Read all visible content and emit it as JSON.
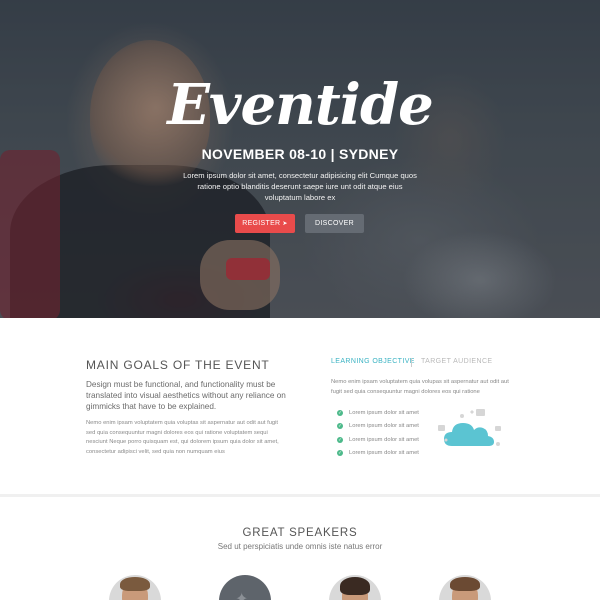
{
  "hero": {
    "logo_text": "Eventide",
    "dates": "NOVEMBER 08-10 | SYDNEY",
    "intro": "Lorem ipsum dolor sit amet, consectetur adipisicing elit Cumque quos ratione optio  blanditis deserunt saepe iure unt odit atque eius voluptatum labore ex",
    "register_label": "REGISTER",
    "register_icon": "chevron-right-circle-icon",
    "discover_label": "DISCOVER",
    "colors": {
      "register": "#e94b4b",
      "discover": "#656b73"
    }
  },
  "goals": {
    "title": "MAIN GOALS OF THE EVENT",
    "lead": "Design must be functional, and functionality must be translated into visual aesthetics without any reliance on gimmicks that have to be explained.",
    "body": "Nemo enim ipsam voluptatem quia voluptas sit aspernatur aut odit aut fugit sed quia consequuntur magni dolores eos qui ratione voluptatem sequi nesciunt Neque porro quisquam est, qui dolorem ipsum quia dolor sit amet, consectetur adipisci velit, sed quia non numquam eius",
    "tabs": [
      {
        "label": "LEARNING OBJECTIVE",
        "active": true
      },
      {
        "label": "TARGET AUDIENCE",
        "active": false
      }
    ],
    "tab_text": "Nemo enim ipsam voluptatem quia volupas sit aspernatur aut odit aut fugit sed quia consequuntur magni dolores eos qui ratione",
    "checklist": [
      "Lorem ipsum dolor sit amet",
      "Lorem ipsum dolor sit amet",
      "Lorem ipsum dolor sit amet",
      "Lorem ipsum dolor sit amet"
    ],
    "colors": {
      "accent": "#3bb3c3",
      "check": "#4cb98a"
    },
    "illustration_icon": "cloud-devices-icon"
  },
  "speakers": {
    "title": "GREAT SPEAKERS",
    "subtitle": "Sed ut perspiciatis unde omnis iste natus error",
    "items": [
      {
        "avatar": "speaker-photo"
      },
      {
        "avatar": "twitter-bird-icon"
      },
      {
        "avatar": "speaker-photo"
      },
      {
        "avatar": "speaker-photo"
      }
    ]
  }
}
